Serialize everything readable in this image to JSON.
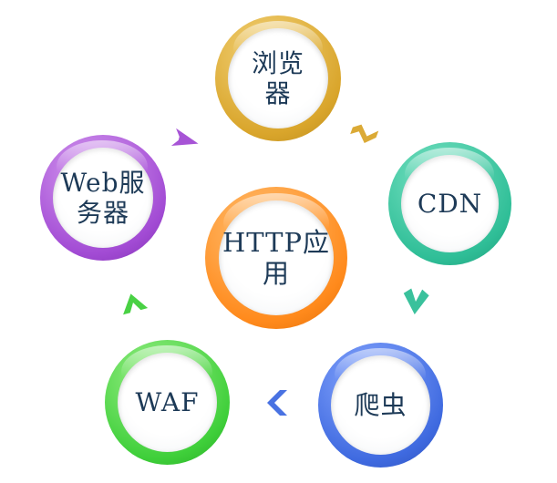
{
  "nodes": [
    {
      "id": "browser",
      "label": "浏览\n器",
      "color": "#d9a52b"
    },
    {
      "id": "cdn",
      "label": "CDN",
      "color": "#2fbe97"
    },
    {
      "id": "crawler",
      "label": "爬虫",
      "color": "#3f6ae0"
    },
    {
      "id": "waf",
      "label": "WAF",
      "color": "#3fcf3a"
    },
    {
      "id": "web_server",
      "label": "Web服\n务器",
      "color": "#a24bd4"
    },
    {
      "id": "http_app",
      "label": "HTTP应\n用",
      "color": "#ff8a1c"
    }
  ],
  "arrows": [
    {
      "from": "browser",
      "to": "cdn",
      "color": "#d9a52b",
      "icon": "chevron-icon"
    },
    {
      "from": "cdn",
      "to": "crawler",
      "color": "#2fbe97",
      "icon": "chevron-icon"
    },
    {
      "from": "crawler",
      "to": "waf",
      "color": "#3f6ae0",
      "icon": "chevron-icon"
    },
    {
      "from": "waf",
      "to": "web_server",
      "color": "#3fcf3a",
      "icon": "chevron-icon"
    },
    {
      "from": "web_server",
      "to": "browser",
      "color": "#a24bd4",
      "icon": "chevron-icon"
    }
  ]
}
